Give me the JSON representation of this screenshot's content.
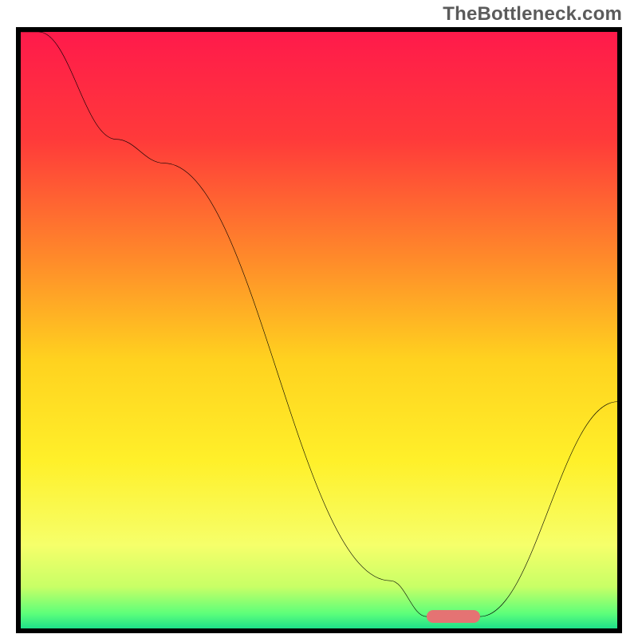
{
  "watermark": "TheBottleneck.com",
  "colors": {
    "border": "#000000",
    "curve": "#000000",
    "marker": "#e57373",
    "gradient_stops": [
      {
        "offset": 0.0,
        "color": "#ff1a4b"
      },
      {
        "offset": 0.18,
        "color": "#ff3a3a"
      },
      {
        "offset": 0.38,
        "color": "#ff8a2a"
      },
      {
        "offset": 0.55,
        "color": "#ffd21f"
      },
      {
        "offset": 0.72,
        "color": "#fff02a"
      },
      {
        "offset": 0.86,
        "color": "#f6ff6a"
      },
      {
        "offset": 0.93,
        "color": "#c8ff66"
      },
      {
        "offset": 0.975,
        "color": "#5dff7a"
      },
      {
        "offset": 1.0,
        "color": "#1ee08a"
      }
    ]
  },
  "chart_data": {
    "type": "line",
    "title": "",
    "xlabel": "",
    "ylabel": "",
    "xlim": [
      0,
      100
    ],
    "ylim": [
      0,
      100
    ],
    "x": [
      0,
      3,
      16,
      24,
      62,
      68,
      72,
      77,
      100
    ],
    "values": [
      100,
      100,
      82,
      78,
      8,
      2,
      2,
      2,
      38
    ],
    "marker": {
      "x_start": 68,
      "x_end": 77,
      "y": 2
    }
  }
}
